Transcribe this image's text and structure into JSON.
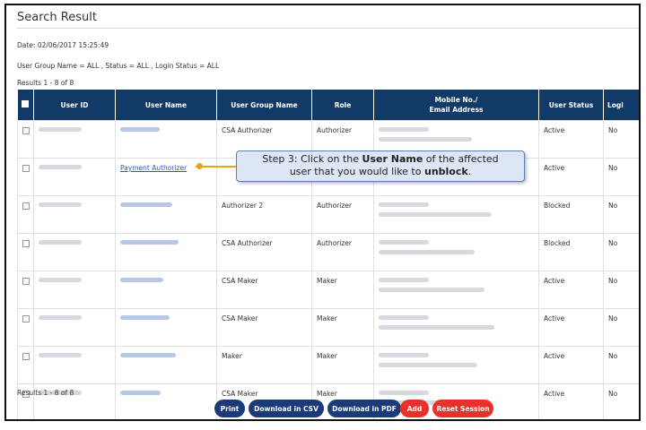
{
  "page": {
    "title": "Search Result",
    "date_line": "Date: 02/06/2017 15:25:49",
    "filter_line": "User Group Name = ALL , Status = ALL , Login Status = ALL",
    "results_top": "Results 1 - 8 of 8",
    "results_bottom": "Results 1 - 8 of 8"
  },
  "table": {
    "headers": {
      "user_id": "User ID",
      "user_name": "User Name",
      "user_group_name": "User Group Name",
      "role": "Role",
      "mobile_line1": "Mobile No./",
      "mobile_line2": "Email Address",
      "user_status": "User Status",
      "login": "Logi"
    },
    "rows": [
      {
        "user_name": "",
        "group": "CSA Authorizer",
        "role": "Authorizer",
        "status": "Active",
        "login": "No"
      },
      {
        "user_name": "Payment Authorizer",
        "group": "",
        "role": "",
        "status": "Active",
        "login": "No"
      },
      {
        "user_name": "",
        "group": "Authorizer 2",
        "role": "Authorizer",
        "status": "Blocked",
        "login": "No"
      },
      {
        "user_name": "",
        "group": "CSA Authorizer",
        "role": "Authorizer",
        "status": "Blocked",
        "login": "No"
      },
      {
        "user_name": "",
        "group": "CSA Maker",
        "role": "Maker",
        "status": "Active",
        "login": "No"
      },
      {
        "user_name": "",
        "group": "CSA Maker",
        "role": "Maker",
        "status": "Active",
        "login": "No"
      },
      {
        "user_name": "",
        "group": "Maker",
        "role": "Maker",
        "status": "Active",
        "login": "No"
      },
      {
        "user_name": "",
        "group": "CSA Maker",
        "role": "Maker",
        "status": "Active",
        "login": "No"
      }
    ]
  },
  "callout": {
    "prefix": "Step 3: Click on the ",
    "bold1": "User Name",
    "middle": " of the affected",
    "line2_prefix": "user that you would like to ",
    "bold2": "unblock",
    "suffix": "."
  },
  "buttons": {
    "print": "Print",
    "csv": "Download in CSV",
    "pdf": "Download in PDF",
    "add": "Add",
    "reset": "Reset Session"
  },
  "colors": {
    "header_bg": "#123a66",
    "primary_button": "#1a3a7a",
    "danger_button": "#e8312a",
    "callout_bg": "#dde6f5",
    "pointer": "#e8a317"
  }
}
